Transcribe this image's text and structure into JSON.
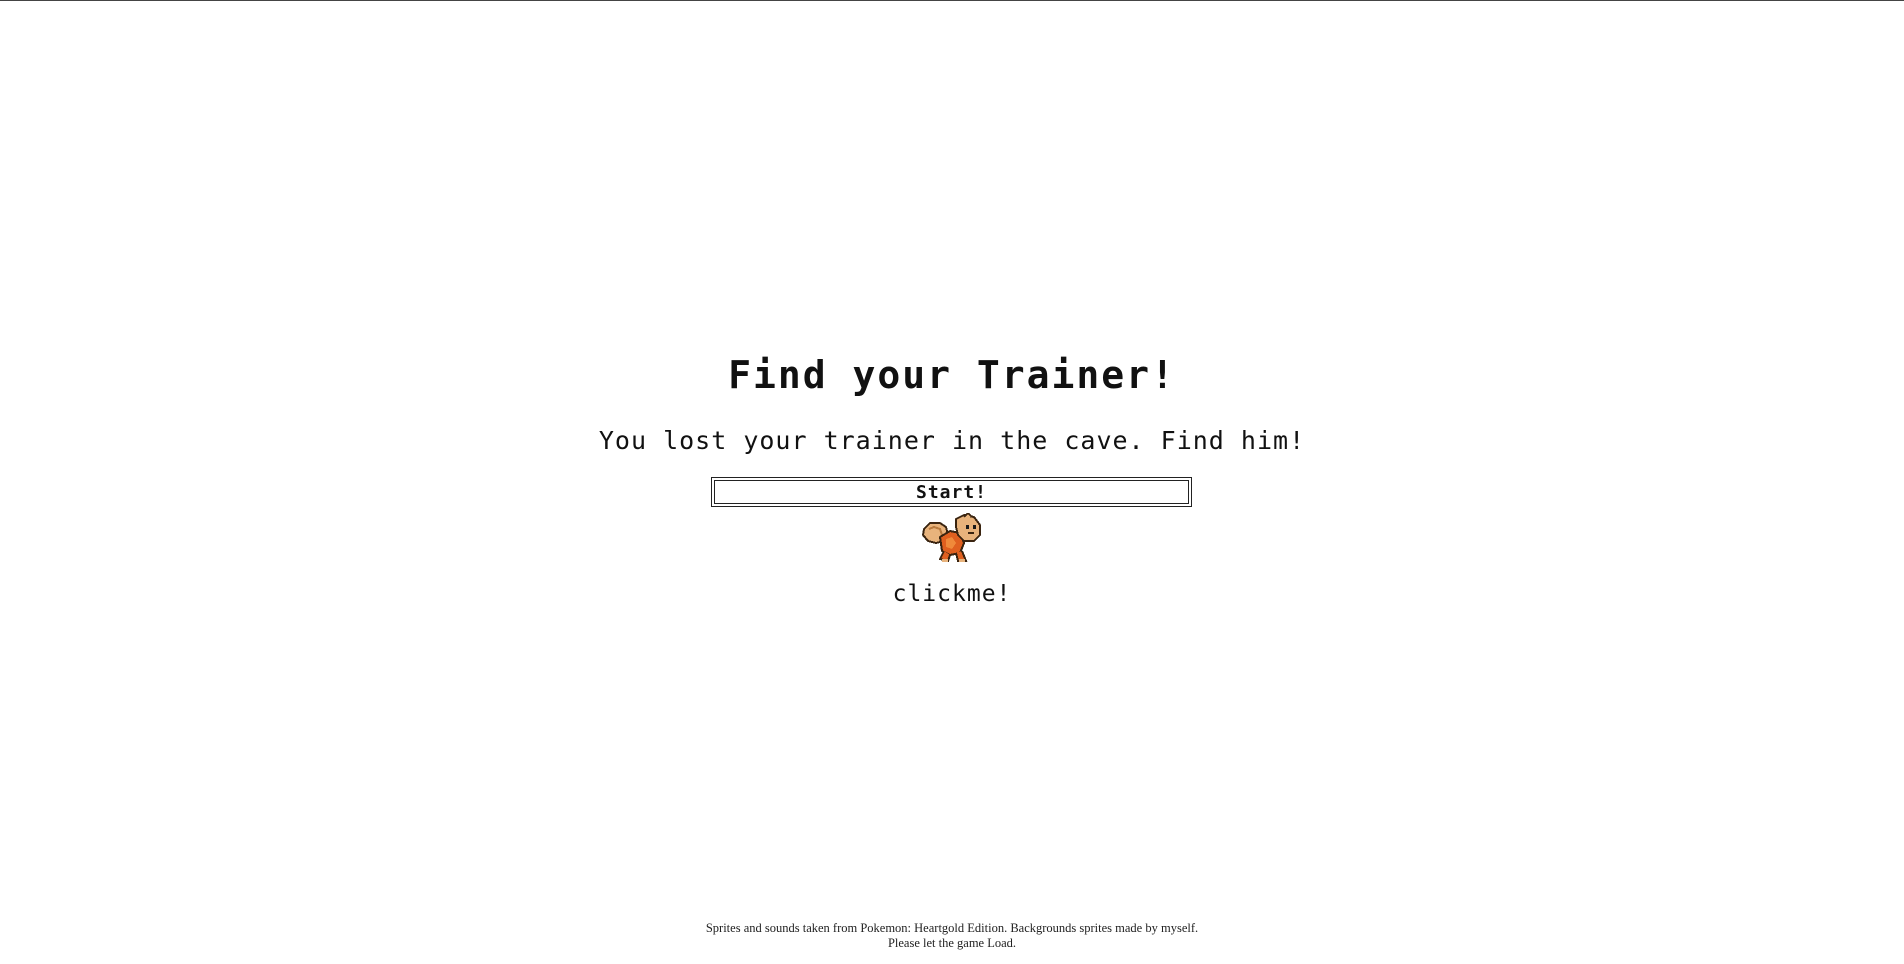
{
  "game": {
    "title": "Find your Trainer!",
    "subtitle": "You lost your trainer in the cave. Find him!",
    "start_label": "Start!",
    "sprite_icon": "pokemon-sprite-icon",
    "clickme_label": "clickme!"
  },
  "footer": {
    "credits": "Sprites and sounds taken from Pokemon: Heartgold Edition. Backgrounds sprites made by myself.",
    "loading_note": "Please let the game Load."
  },
  "colors": {
    "background": "#ffffff",
    "text": "#111111",
    "sprite_tan": "#d9a46a",
    "sprite_orange": "#e0601f"
  }
}
